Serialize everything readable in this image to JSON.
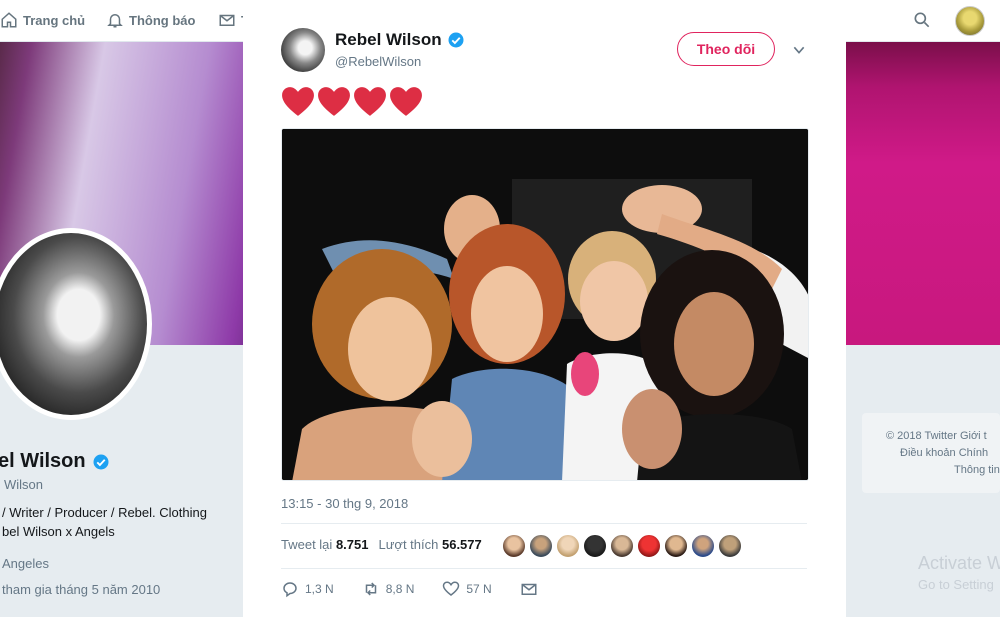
{
  "nav": {
    "home_label": "Trang chủ",
    "notifications_label": "Thông báo",
    "messages_label": "T"
  },
  "profile": {
    "name": "el Wilson",
    "handle": "Wilson",
    "bio_line1": "/ Writer / Producer / Rebel. Clothing",
    "bio_line2": "bel Wilson x Angels",
    "location": "Angeles",
    "joined": "tham gia tháng 5 năm 2010"
  },
  "sidebar_footer": {
    "line1": "© 2018 Twitter   Giới t",
    "line2": "Điều khoản   Chính",
    "line3": "Thông tin"
  },
  "activate_windows": {
    "title": "Activate W",
    "subtitle": "Go to Setting"
  },
  "tweet": {
    "author_name": "Rebel Wilson",
    "author_handle": "@RebelWilson",
    "follow_label": "Theo dõi",
    "text_emoji": [
      "heart-icon",
      "heart-icon",
      "heart-icon",
      "heart-icon"
    ],
    "timestamp": "13:15 - 30 thg 9, 2018",
    "retweets_label": "Tweet lại",
    "retweets_count": "8.751",
    "likes_label": "Lượt thích",
    "likes_count": "56.577",
    "reply_count": "1,3 N",
    "retweet_action_count": "8,8 N",
    "like_action_count": "57 N"
  },
  "colors": {
    "accent_red": "#e0245e",
    "verified_blue": "#1da1f2",
    "muted_text": "#657786"
  }
}
